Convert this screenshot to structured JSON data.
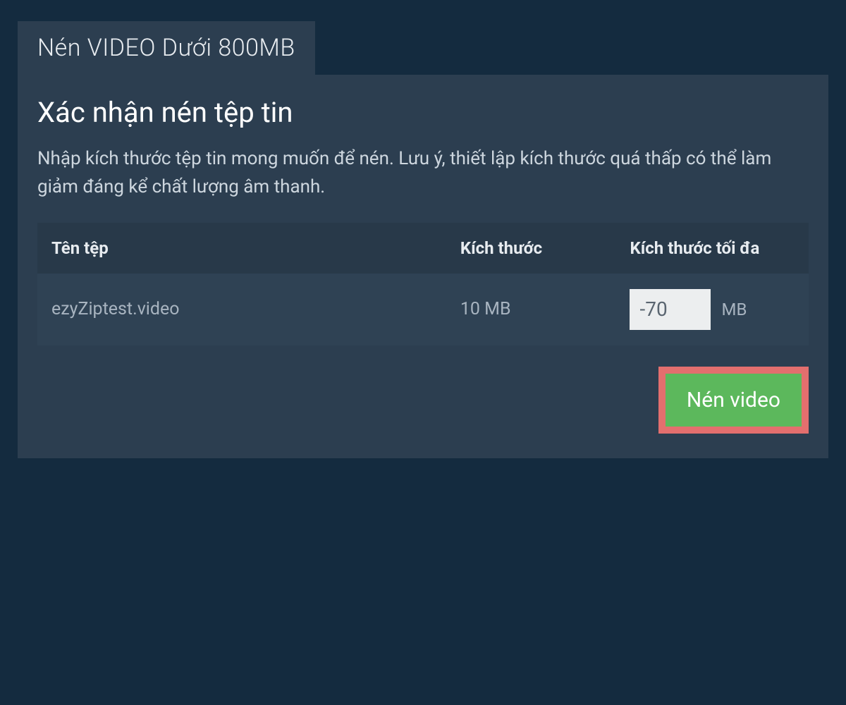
{
  "tab": {
    "label": "Nén VIDEO Dưới 800MB"
  },
  "panel": {
    "heading": "Xác nhận nén tệp tin",
    "description": "Nhập kích thước tệp tin mong muốn để nén. Lưu ý, thiết lập kích thước quá thấp có thể làm giảm đáng kể chất lượng âm thanh."
  },
  "table": {
    "headers": {
      "filename": "Tên tệp",
      "size": "Kích thước",
      "maxSize": "Kích thước tối đa"
    },
    "rows": [
      {
        "filename": "ezyZiptest.video",
        "size": "10 MB",
        "maxSizeValue": "-70",
        "maxSizeUnit": "MB"
      }
    ]
  },
  "actions": {
    "compress": "Nén video"
  },
  "colors": {
    "pageBackground": "#142b3f",
    "panelBackground": "#2c3e50",
    "headerRowBackground": "#283949",
    "dataRowBackground": "#2f4254",
    "buttonBackground": "#5cb85c",
    "buttonBorder": "#e36f6e",
    "inputBackground": "#eceeef",
    "textLight": "#e8ecf0",
    "textMuted": "#a8b4c0"
  }
}
